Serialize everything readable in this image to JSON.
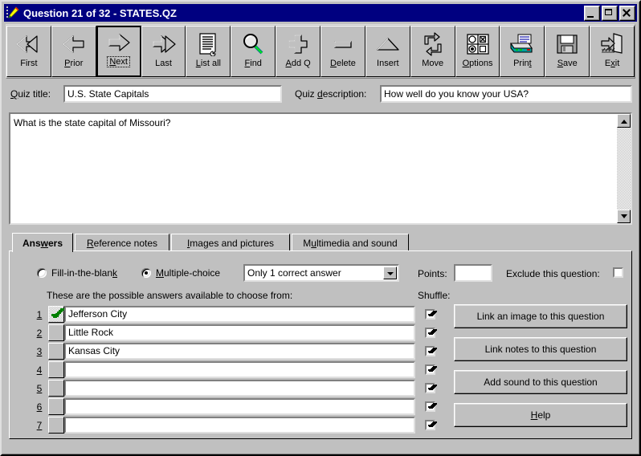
{
  "window": {
    "title": "Question 21 of 32 - STATES.QZ",
    "icon": "pencil-icon",
    "controls": {
      "minimize": "minimize-button",
      "maximize": "maximize-button",
      "close": "close-button"
    },
    "colors": {
      "titlebar": "#000080",
      "face": "#c0c0c0",
      "shadow": "#808080",
      "highlight": "#ffffff",
      "correct_check": "#008000"
    }
  },
  "toolbar": {
    "buttons": [
      {
        "label": "First",
        "acc": "",
        "icon": "double-arrow-left-icon",
        "focused": false
      },
      {
        "label": "Prior",
        "acc": "P",
        "icon": "arrow-left-icon",
        "focused": false
      },
      {
        "label": "Next",
        "acc": "N",
        "icon": "arrow-right-icon",
        "focused": true
      },
      {
        "label": "Last",
        "acc": "",
        "icon": "double-arrow-right-icon",
        "focused": false
      },
      {
        "label": "List all",
        "acc": "L",
        "icon": "document-list-icon",
        "focused": false
      },
      {
        "label": "Find",
        "acc": "F",
        "icon": "magnifier-icon",
        "focused": false
      },
      {
        "label": "Add Q",
        "acc": "A",
        "icon": "plus-cross-icon",
        "focused": false
      },
      {
        "label": "Delete",
        "acc": "D",
        "icon": "minus-bar-icon",
        "focused": false
      },
      {
        "label": "Insert",
        "acc": "",
        "icon": "triangle-up-icon",
        "focused": false
      },
      {
        "label": "Move",
        "acc": "",
        "icon": "two-arrows-cycle-icon",
        "focused": false
      },
      {
        "label": "Options",
        "acc": "O",
        "icon": "options-grid-icon",
        "focused": false
      },
      {
        "label": "Print",
        "acc": "t",
        "icon": "printer-icon",
        "focused": false
      },
      {
        "label": "Save",
        "acc": "S",
        "icon": "floppy-disk-icon",
        "focused": false
      },
      {
        "label": "Exit",
        "acc": "x",
        "icon": "exit-door-icon",
        "focused": false
      }
    ]
  },
  "fields": {
    "quiz_title_label": "Quiz title:",
    "quiz_title_acc": "Q",
    "quiz_title_value": "U.S. State Capitals",
    "quiz_desc_label": "Quiz description:",
    "quiz_desc_acc": "d",
    "quiz_desc_value": "How well do you know your USA?"
  },
  "question": {
    "text": "What is the state capital of Missouri?",
    "scrollbar": {
      "up": "scroll-up-arrow",
      "down": "scroll-down-arrow"
    }
  },
  "tabs": [
    {
      "label": "Answers",
      "acc": "w",
      "active": true
    },
    {
      "label": "Reference notes",
      "acc": "R",
      "active": false
    },
    {
      "label": "Images and pictures",
      "acc": "I",
      "active": false
    },
    {
      "label": "Multimedia and sound",
      "acc": "u",
      "active": false
    }
  ],
  "answers_panel": {
    "type_radios": [
      {
        "label": "Fill-in-the-blank",
        "acc": "k",
        "checked": false
      },
      {
        "label": "Multiple-choice",
        "acc": "M",
        "checked": true
      }
    ],
    "combo": {
      "value": "Only 1 correct answer",
      "options": [
        "Only 1 correct answer"
      ]
    },
    "points_label": "Points:",
    "points_value": "",
    "exclude_label": "Exclude this question:",
    "exclude_checked": false,
    "answers_caption": "These are the possible answers available to choose from:",
    "shuffle_caption": "Shuffle:",
    "rows": [
      {
        "num": "1",
        "text": "Jefferson City",
        "correct": true,
        "shuffle": true
      },
      {
        "num": "2",
        "text": "Little Rock",
        "correct": false,
        "shuffle": true
      },
      {
        "num": "3",
        "text": "Kansas City",
        "correct": false,
        "shuffle": true
      },
      {
        "num": "4",
        "text": "",
        "correct": false,
        "shuffle": true
      },
      {
        "num": "5",
        "text": "",
        "correct": false,
        "shuffle": true
      },
      {
        "num": "6",
        "text": "",
        "correct": false,
        "shuffle": true
      },
      {
        "num": "7",
        "text": "",
        "correct": false,
        "shuffle": true
      }
    ],
    "side_buttons": [
      {
        "label": "Link an image to this question",
        "acc": ""
      },
      {
        "label": "Link notes to this question",
        "acc": ""
      },
      {
        "label": "Add sound to this question",
        "acc": ""
      },
      {
        "label": "Help",
        "acc": "H"
      }
    ]
  }
}
